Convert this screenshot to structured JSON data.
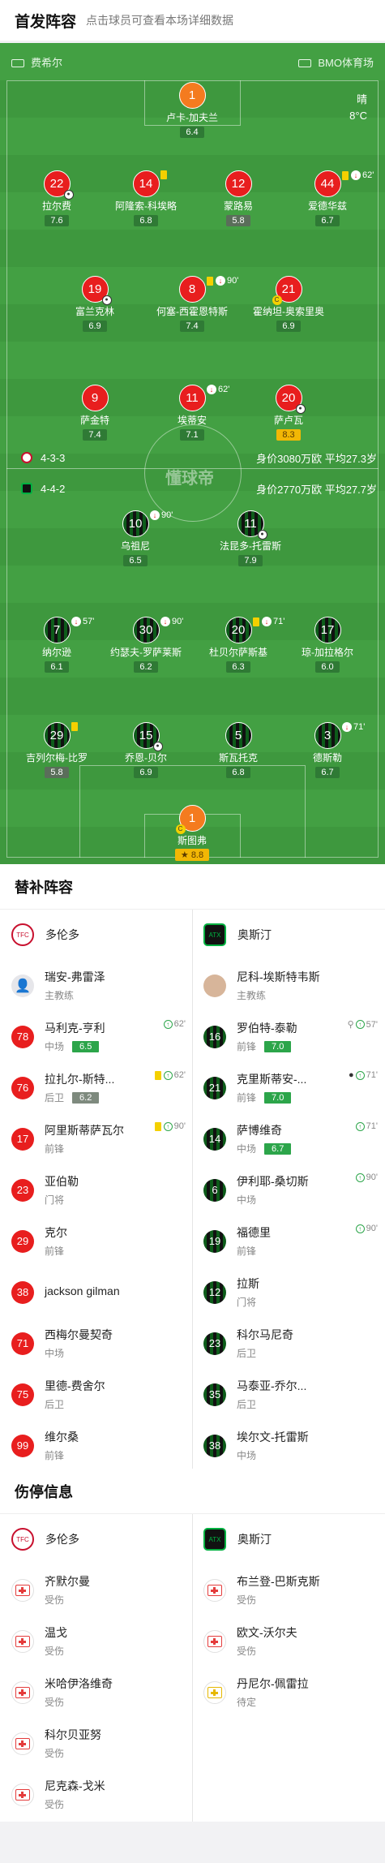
{
  "header": {
    "title": "首发阵容",
    "subtitle": "点击球员可查看本场详细数据"
  },
  "pitch": {
    "home_stadium_label": "费希尔",
    "venue": "BMO体育场",
    "weather": "晴",
    "temperature": "8°C",
    "watermark": "懂球帝",
    "home_formation": "4-3-3",
    "home_stats": "身价3080万欧 平均27.3岁",
    "away_formation": "4-4-2",
    "away_stats": "身价2770万欧 平均27.7岁"
  },
  "home_players": [
    {
      "num": "1",
      "name": "卢卡-加夫兰",
      "rating": "6.4"
    },
    {
      "num": "22",
      "name": "拉尔费",
      "rating": "7.6"
    },
    {
      "num": "14",
      "name": "阿隆索-科埃略",
      "rating": "6.8"
    },
    {
      "num": "12",
      "name": "蒙路易",
      "rating": "5.8"
    },
    {
      "num": "44",
      "name": "爱德华兹",
      "rating": "6.7",
      "sub_minute": "62'"
    },
    {
      "num": "19",
      "name": "富兰克林",
      "rating": "6.9"
    },
    {
      "num": "8",
      "name": "何塞-西霍恩特斯",
      "rating": "7.4",
      "sub_minute": "90'"
    },
    {
      "num": "21",
      "name": "霍纳坦-奥索里奥",
      "rating": "6.9"
    },
    {
      "num": "9",
      "name": "萨金特",
      "rating": "7.4"
    },
    {
      "num": "11",
      "name": "埃蒂安",
      "rating": "7.1",
      "sub_minute": "62'"
    },
    {
      "num": "20",
      "name": "萨卢瓦",
      "rating": "8.3"
    }
  ],
  "away_players": [
    {
      "num": "10",
      "name": "乌祖尼",
      "rating": "6.5",
      "sub_minute": "90'"
    },
    {
      "num": "11",
      "name": "法昆多-托雷斯",
      "rating": "7.9"
    },
    {
      "num": "7",
      "name": "纳尔逊",
      "rating": "6.1",
      "sub_minute": "57'"
    },
    {
      "num": "30",
      "name": "约瑟夫-罗萨莱斯",
      "rating": "6.2",
      "sub_minute": "90'"
    },
    {
      "num": "20",
      "name": "杜贝尔萨斯基",
      "rating": "6.3",
      "sub_minute": "71'"
    },
    {
      "num": "17",
      "name": "琼-加拉格尔",
      "rating": "6.0"
    },
    {
      "num": "29",
      "name": "吉列尔梅-比罗",
      "rating": "5.8"
    },
    {
      "num": "15",
      "name": "乔恩-贝尔",
      "rating": "6.9"
    },
    {
      "num": "5",
      "name": "斯瓦托克",
      "rating": "6.8"
    },
    {
      "num": "3",
      "name": "德斯勒",
      "rating": "6.7",
      "sub_minute": "71'"
    },
    {
      "num": "1",
      "name": "斯图弗",
      "rating": "8.8"
    }
  ],
  "subs": {
    "title": "替补阵容",
    "home_team": "多伦多",
    "away_team": "奥斯汀",
    "home_coach": {
      "name": "瑞安-弗雷泽",
      "role": "主教练"
    },
    "away_coach": {
      "name": "尼科-埃斯特韦斯",
      "role": "主教练"
    },
    "home": [
      {
        "num": "78",
        "name": "马利克-亨利",
        "pos": "中场",
        "rating": "6.5",
        "minute": "62'"
      },
      {
        "num": "76",
        "name": "拉扎尔-斯特...",
        "pos": "后卫",
        "rating": "6.2",
        "minute": "62'"
      },
      {
        "num": "17",
        "name": "阿里斯蒂萨瓦尔",
        "pos": "前锋",
        "minute": "90'"
      },
      {
        "num": "23",
        "name": "亚伯勒",
        "pos": "门将"
      },
      {
        "num": "29",
        "name": "克尔",
        "pos": "前锋"
      },
      {
        "num": "38",
        "name": "jackson gilman",
        "pos": ""
      },
      {
        "num": "71",
        "name": "西梅尔曼契奇",
        "pos": "中场"
      },
      {
        "num": "75",
        "name": "里德-费舍尔",
        "pos": "后卫"
      },
      {
        "num": "99",
        "name": "维尔桑",
        "pos": "前锋"
      }
    ],
    "away": [
      {
        "num": "16",
        "name": "罗伯特-泰勒",
        "pos": "前锋",
        "rating": "7.0",
        "minute": "57'"
      },
      {
        "num": "21",
        "name": "克里斯蒂安-...",
        "pos": "前锋",
        "rating": "7.0",
        "minute": "71'"
      },
      {
        "num": "14",
        "name": "萨博维奇",
        "pos": "中场",
        "rating": "6.7",
        "minute": "71'"
      },
      {
        "num": "6",
        "name": "伊利耶-桑切斯",
        "pos": "中场",
        "minute": "90'"
      },
      {
        "num": "19",
        "name": "福德里",
        "pos": "前锋",
        "minute": "90'"
      },
      {
        "num": "12",
        "name": "拉斯",
        "pos": "门将"
      },
      {
        "num": "23",
        "name": "科尔马尼奇",
        "pos": "后卫"
      },
      {
        "num": "35",
        "name": "马泰亚-乔尔...",
        "pos": "后卫"
      },
      {
        "num": "38",
        "name": "埃尔文-托雷斯",
        "pos": "中场"
      }
    ]
  },
  "injuries": {
    "title": "伤停信息",
    "home_team": "多伦多",
    "away_team": "奥斯汀",
    "home": [
      {
        "name": "齐默尔曼",
        "status": "受伤"
      },
      {
        "name": "温戈",
        "status": "受伤"
      },
      {
        "name": "米哈伊洛维奇",
        "status": "受伤"
      },
      {
        "name": "科尔贝亚努",
        "status": "受伤"
      },
      {
        "name": "尼克森-戈米",
        "status": "受伤"
      }
    ],
    "away": [
      {
        "name": "布兰登-巴斯克斯",
        "status": "受伤"
      },
      {
        "name": "欧文-沃尔夫",
        "status": "受伤"
      },
      {
        "name": "丹尼尔-佩雷拉",
        "status": "待定"
      }
    ]
  },
  "colors": {
    "pitch": "#43a043",
    "home": "#e81e1e",
    "home_gk": "#f47b1f",
    "away": "#0d5c1a",
    "accent": "#2ca54a"
  }
}
